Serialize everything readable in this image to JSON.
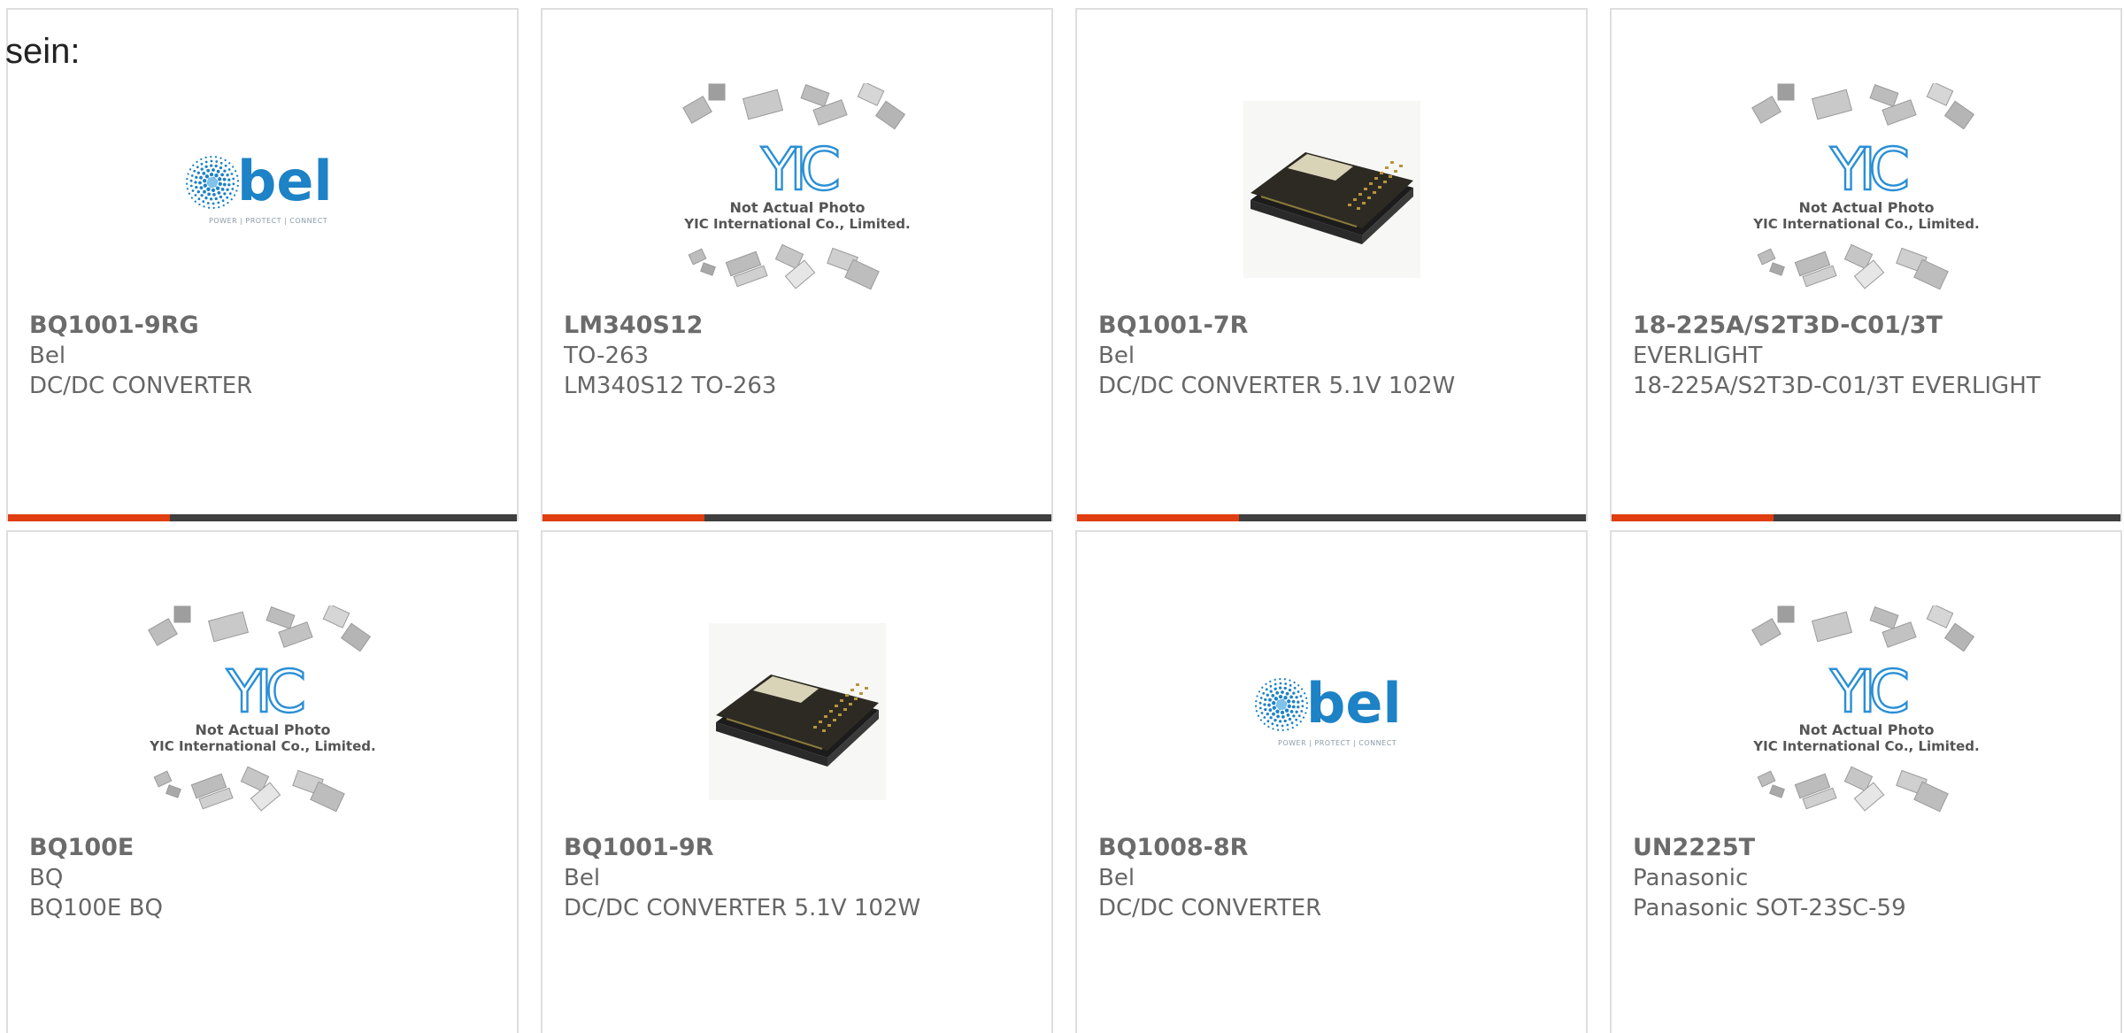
{
  "intro_text": "sein:",
  "colors": {
    "accent_bar": "#e03d10",
    "dark_bar": "#3f3f3f",
    "bel_blue": "#1d82c6",
    "yic_blue": "#2a8fd6"
  },
  "placeholder": {
    "caption_line1": "Not Actual Photo",
    "caption_line2": "YIC International Co., Limited.",
    "logo_text": "YIC"
  },
  "bel_logo": {
    "wordmark": "bel",
    "tagline": "POWER | PROTECT | CONNECT"
  },
  "products": [
    {
      "part": "BQ1001-9RG",
      "brand": "Bel",
      "desc": "DC/DC CONVERTER",
      "image": "bel-logo"
    },
    {
      "part": "LM340S12",
      "brand": "TO-263",
      "desc": "LM340S12 TO-263",
      "image": "yic-placeholder"
    },
    {
      "part": "BQ1001-7R",
      "brand": "Bel",
      "desc": "DC/DC CONVERTER 5.1V 102W",
      "image": "converter-photo"
    },
    {
      "part": "18-225A/S2T3D-C01/3T",
      "brand": "EVERLIGHT",
      "desc": "18-225A/S2T3D-C01/3T EVERLIGHT",
      "image": "yic-placeholder"
    },
    {
      "part": "BQ100E",
      "brand": "BQ",
      "desc": "BQ100E BQ",
      "image": "yic-placeholder"
    },
    {
      "part": "BQ1001-9R",
      "brand": "Bel",
      "desc": "DC/DC CONVERTER 5.1V 102W",
      "image": "converter-photo"
    },
    {
      "part": "BQ1008-8R",
      "brand": "Bel",
      "desc": "DC/DC CONVERTER",
      "image": "bel-logo"
    },
    {
      "part": "UN2225T",
      "brand": "Panasonic",
      "desc": "Panasonic SOT-23SC-59",
      "image": "yic-placeholder"
    }
  ]
}
